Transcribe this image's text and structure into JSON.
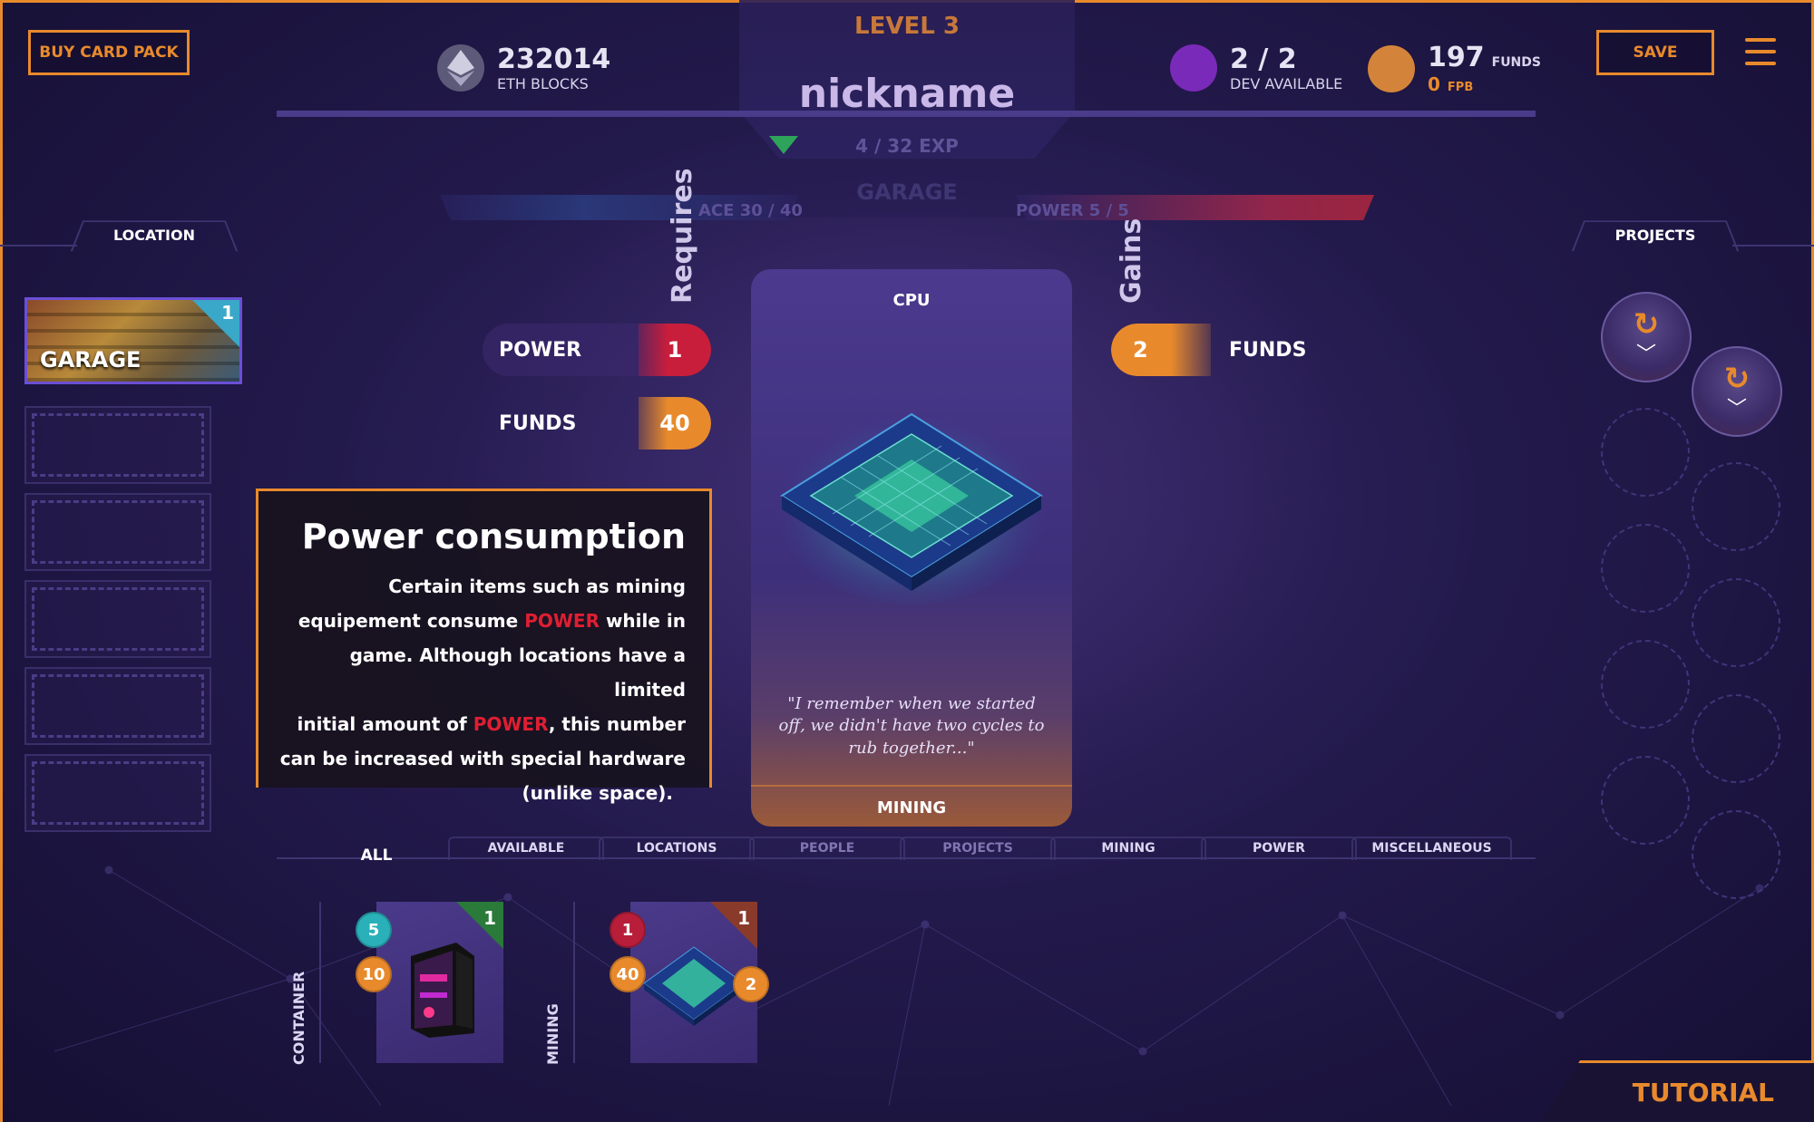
{
  "header": {
    "buy_pack": "BUY CARD PACK",
    "save": "SAVE",
    "level": "LEVEL 3",
    "nickname": "nickname",
    "exp": "4 / 32 EXP",
    "eth_value": "232014",
    "eth_label": "ETH BLOCKS",
    "dev_value": "2 / 2",
    "dev_label": "DEV AVAILABLE",
    "funds_value": "197",
    "funds_label": "FUNDS",
    "fpb_value": "0",
    "fpb_label": "FPB"
  },
  "ghost": {
    "space": "ACE 30 / 40",
    "power": "POWER 5 / 5",
    "location": "GARAGE"
  },
  "left_panel": {
    "title": "LOCATION",
    "active_location": "GARAGE",
    "active_count": "1"
  },
  "right_panel": {
    "title": "PROJECTS"
  },
  "detail": {
    "requires_title": "Requires",
    "gains_title": "Gains",
    "requires": [
      {
        "name": "POWER",
        "value": "1"
      },
      {
        "name": "FUNDS",
        "value": "40"
      }
    ],
    "gains": [
      {
        "name": "FUNDS",
        "value": "2"
      }
    ],
    "card": {
      "title": "CPU",
      "quote": "\"I remember when we started off, we didn't have two cycles to rub together...\"",
      "type": "MINING"
    }
  },
  "tooltip": {
    "title": "Power consumption",
    "t1": "Certain items such as mining",
    "t2a": "equipement consume ",
    "t2b": "POWER",
    "t2c": " while in",
    "t3": "game. Although locations have a limited",
    "t4a": "initial amount of ",
    "t4b": "POWER",
    "t4c": ", this number",
    "t5": "can be increased with special hardware",
    "t6": "(unlike space)."
  },
  "tabs": [
    "ALL",
    "AVAILABLE",
    "LOCATIONS",
    "PEOPLE",
    "PROJECTS",
    "MINING",
    "POWER",
    "MISCELLANEOUS"
  ],
  "hand": {
    "groups": [
      {
        "category": "CONTAINER",
        "count": "1",
        "badge_a": "5",
        "badge_b": "10"
      },
      {
        "category": "MINING",
        "count": "1",
        "badge_a": "1",
        "badge_b": "40",
        "badge_c": "2"
      }
    ]
  },
  "tutorial": "TUTORIAL",
  "colors": {
    "accent": "#e88a2c",
    "power": "#c81e3c",
    "dev": "#7a2ab8",
    "funds": "#d4843a"
  }
}
